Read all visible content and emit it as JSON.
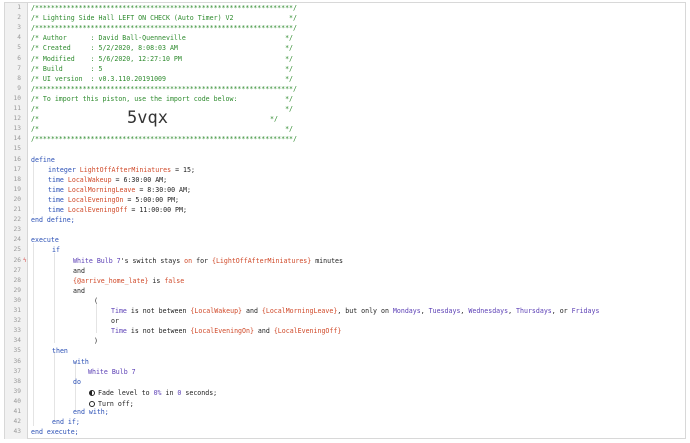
{
  "gutter": {
    "numbers": [
      "1",
      "2",
      "3",
      "4",
      "5",
      "6",
      "7",
      "8",
      "9",
      "10",
      "11",
      "12",
      "13",
      "14",
      "15",
      "16",
      "17",
      "18",
      "19",
      "20",
      "21",
      "22",
      "23",
      "24",
      "25",
      "26",
      "27",
      "28",
      "29",
      "30",
      "31",
      "32",
      "33",
      "34",
      "35",
      "36",
      "37",
      "38",
      "39",
      "40",
      "41",
      "42",
      "43"
    ],
    "breakpoint_line": "26",
    "breakpoint_icon": "bolt-icon"
  },
  "header": {
    "border": "/*****************************************************************/",
    "l2": "/* Lighting Side Hall LEFT ON CHECK (Auto Timer) V2              */",
    "l4": "/* Author      : David Ball-Quenneville                         */",
    "l5": "/* Created     : 5/2/2020, 8:08:03 AM                           */",
    "l6": "/* Modified    : 5/6/2020, 12:27:10 PM                          */",
    "l7": "/* Build       : 5                                              */",
    "l8": "/* UI version  : v0.3.110.20191009                              */",
    "l10": "/* To import this piston, use the import code below:            */",
    "l11": "/*                                                              */",
    "l12_pre": "/*",
    "l12_code": "5vqx",
    "l12_post": "*/",
    "l13": "/*                                                              */"
  },
  "define": {
    "start": "define",
    "v1_type": "integer",
    "v1_name": "LightOffAfterMiniatures",
    "v1_val": " = 15;",
    "v2_type": "time",
    "v2_name": "LocalWakeup",
    "v2_val": " = 6:30:00 AM;",
    "v3_type": "time",
    "v3_name": "LocalMorningLeave",
    "v3_val": " = 8:30:00 AM;",
    "v4_type": "time",
    "v4_name": "LocalEveningOn",
    "v4_val": " = 5:00:00 PM;",
    "v5_type": "time",
    "v5_name": "LocalEveningOff",
    "v5_val": " = 11:00:00 PM;",
    "end": "end define;"
  },
  "execute": {
    "start": "execute",
    "if": "if",
    "c1_dev": "White Bulb 7",
    "c1_mid": "'s switch stays ",
    "c1_on": "on",
    "c1_for": " for ",
    "c1_var": "{LightOffAfterMiniatures}",
    "c1_end": " minutes",
    "and1": "and",
    "c2_var": "{@arrive_home_late}",
    "c2_is": " is ",
    "c2_false": "false",
    "and2": "and",
    "paren_open": "(",
    "t1_time": "Time",
    "t1_mid": " is not between ",
    "t1_a": "{LocalWakeup}",
    "t1_and": " and ",
    "t1_b": "{LocalMorningLeave}",
    "t1_only": ", but only on ",
    "d1": "Mondays",
    "d_sep1": ", ",
    "d2": "Tuesdays",
    "d_sep2": ", ",
    "d3": "Wednesdays",
    "d_sep3": ", ",
    "d4": "Thursdays",
    "d_sep4": ", or ",
    "d5": "Fridays",
    "or": "or",
    "t2_time": "Time",
    "t2_mid": " is not between ",
    "t2_a": "{LocalEveningOn}",
    "t2_and": " and ",
    "t2_b": "{LocalEveningOff}",
    "paren_close": ")",
    "then": "then",
    "with": "with",
    "with_dev": "White Bulb 7",
    "do": "do",
    "a1_pre": "Fade level to ",
    "a1_lvl": "0%",
    "a1_in": " in ",
    "a1_sec": "0",
    "a1_end": " seconds;",
    "a1_icon": "fade-icon",
    "a2": "Turn off;",
    "a2_icon": "power-icon",
    "end_with": "end with;",
    "end_if": "end if;",
    "end": "end execute;"
  }
}
